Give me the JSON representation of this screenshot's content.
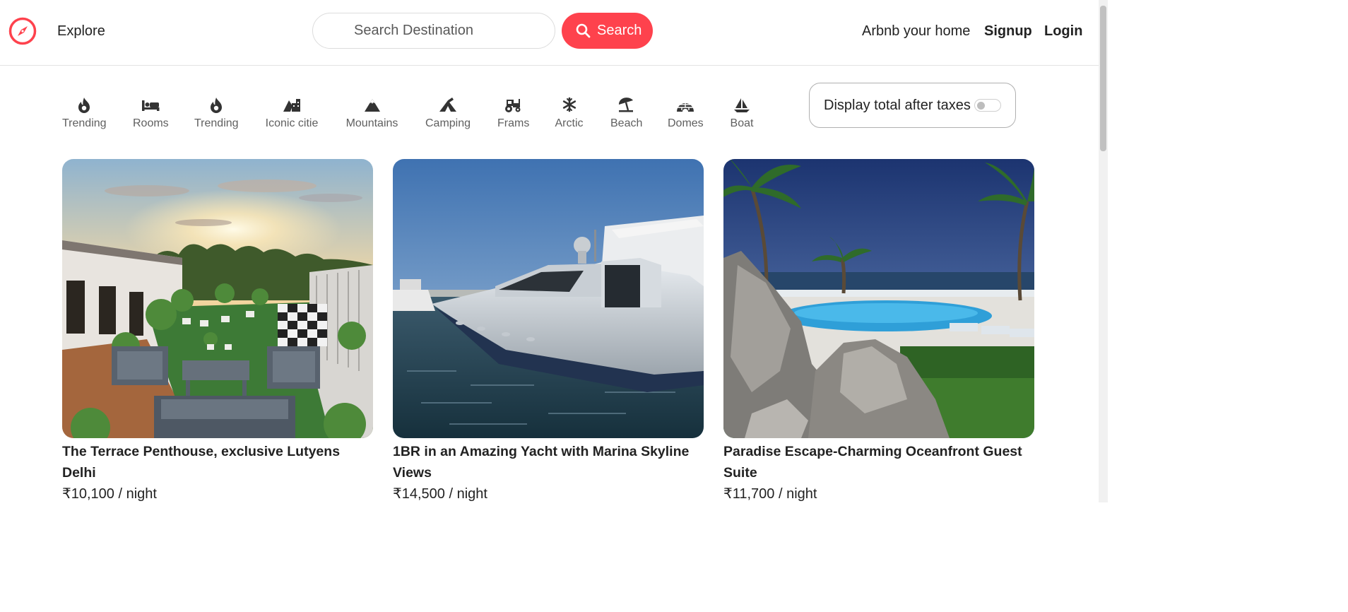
{
  "navbar": {
    "logo_icon": "compass-icon",
    "explore_label": "Explore",
    "search_placeholder": "Search Destination",
    "search_button_label": "Search",
    "host_label": "Arbnb your home",
    "signup_label": "Signup",
    "login_label": "Login",
    "accent_color": "#fe424d"
  },
  "filters": [
    {
      "label": "Trending",
      "icon": "fire-icon"
    },
    {
      "label": "Rooms",
      "icon": "bed-icon"
    },
    {
      "label": "Trending",
      "icon": "fire-icon"
    },
    {
      "label": "Iconic citie",
      "icon": "mountain-city-icon"
    },
    {
      "label": "Mountains",
      "icon": "mountain-icon"
    },
    {
      "label": "Camping",
      "icon": "campground-icon"
    },
    {
      "label": "Frams",
      "icon": "tractor-icon"
    },
    {
      "label": "Arctic",
      "icon": "snowflake-icon"
    },
    {
      "label": "Beach",
      "icon": "umbrella-beach-icon"
    },
    {
      "label": "Domes",
      "icon": "igloo-icon"
    },
    {
      "label": "Boat",
      "icon": "sailboat-icon"
    }
  ],
  "tax_toggle": {
    "label": "Display total after taxes",
    "enabled": false
  },
  "listings": [
    {
      "title": "The Terrace Penthouse, exclusive Lutyens Delhi",
      "price": "₹10,100 / night",
      "image": "rooftop terrace garden at sunset"
    },
    {
      "title": "1BR in an Amazing Yacht with Marina Skyline Views",
      "price": "₹14,500 / night",
      "image": "silver yacht docked in marina"
    },
    {
      "title": "Paradise Escape-Charming Oceanfront Guest Suite",
      "price": "₹11,700 / night",
      "image": "oceanfront pool with palm trees and rocks"
    }
  ]
}
